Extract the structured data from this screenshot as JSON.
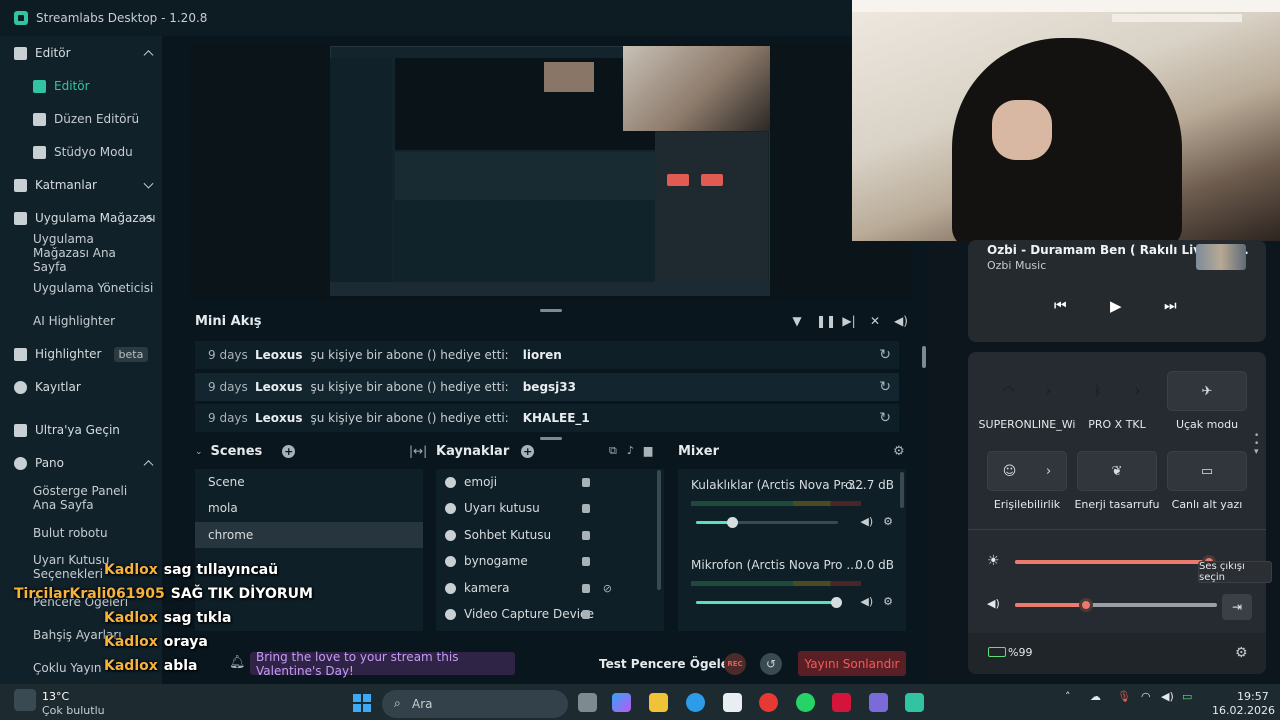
{
  "app": {
    "title": "Streamlabs Desktop - 1.20.8"
  },
  "sidebar": {
    "items": [
      {
        "label": "Editör"
      },
      {
        "label": "Editör"
      },
      {
        "label": "Düzen Editörü"
      },
      {
        "label": "Stüdyo Modu"
      },
      {
        "label": "Katmanlar"
      },
      {
        "label": "Uygulama Mağazası"
      },
      {
        "label": "Uygulama Mağazası Ana Sayfa"
      },
      {
        "label": "Uygulama Yöneticisi"
      },
      {
        "label": "AI Highlighter"
      },
      {
        "label": "Highlighter"
      },
      {
        "label": "Kayıtlar"
      },
      {
        "label": "Ultra'ya Geçin"
      },
      {
        "label": "Pano"
      },
      {
        "label": "Gösterge Paneli Ana Sayfa"
      },
      {
        "label": "Bulut robotu"
      },
      {
        "label": "Uyarı Kutusu Seçenekleri"
      },
      {
        "label": "Pencere Ögeleri"
      },
      {
        "label": "Bahşiş Ayarları"
      },
      {
        "label": "Çoklu Yayın"
      }
    ],
    "beta_badge": "beta"
  },
  "mini_feed": {
    "title": "Mini Akış",
    "rows": [
      {
        "age": "9 days",
        "user": "Leoxus",
        "text": "şu kişiye bir abone () hediye etti:",
        "target": "lioren"
      },
      {
        "age": "9 days",
        "user": "Leoxus",
        "text": "şu kişiye bir abone () hediye etti:",
        "target": "begsj33"
      },
      {
        "age": "9 days",
        "user": "Leoxus",
        "text": "şu kişiye bir abone () hediye etti:",
        "target": "KHALEE_1"
      }
    ]
  },
  "scenes": {
    "title": "Scenes",
    "items": [
      "Scene",
      "mola",
      "chrome"
    ],
    "selected": "chrome"
  },
  "sources": {
    "title": "Kaynaklar",
    "items": [
      "emoji",
      "Uyarı kutusu",
      "Sohbet Kutusu",
      "bynogame",
      "kamera",
      "Video Capture Device"
    ]
  },
  "mixer": {
    "title": "Mixer",
    "channels": [
      {
        "name": "Kulaklıklar (Arctis Nova Pro...",
        "value": "-32.7 dB",
        "level": 0.26
      },
      {
        "name": "Mikrofon (Arctis Nova Pro ...",
        "value": "0.0 dB",
        "level": 0.99
      }
    ]
  },
  "footer": {
    "banner": "Bring the love to your stream this Valentine's Day!",
    "test_label": "Test Pencere Ögeleri",
    "rec_label": "REC",
    "end_stream": "Yayını Sonlandır"
  },
  "chat_overlay": [
    {
      "user": "Kadlox",
      "msg": "sag tıllayıncaü"
    },
    {
      "user": "TircilarKrali061905",
      "msg": "SAĞ TIK DİYORUM"
    },
    {
      "user": "Kadlox",
      "msg": "sag tıkla"
    },
    {
      "user": "Kadlox",
      "msg": "oraya"
    },
    {
      "user": "Kadlox",
      "msg": "abla"
    }
  ],
  "media": {
    "title": "Ozbi - Duramam Ben ( Rakılı Live 4.S...",
    "artist": "Ozbi Music"
  },
  "quick_settings": {
    "tiles": [
      {
        "label": "SUPERONLINE_Wi",
        "on": true
      },
      {
        "label": "PRO X TKL",
        "on": true
      },
      {
        "label": "Uçak modu",
        "on": false
      },
      {
        "label": "Erişilebilirlik",
        "on": false
      },
      {
        "label": "Enerji tasarrufu",
        "on": false
      },
      {
        "label": "Canlı alt yazı",
        "on": false
      }
    ],
    "brightness": 0.97,
    "volume": 0.35,
    "tooltip": "Ses çıkışı seçin",
    "battery": "%99"
  },
  "weather": {
    "temp": "13°C",
    "desc": "Çok bulutlu"
  },
  "taskbar": {
    "search": "Ara",
    "time": "19:57",
    "date": "16.02.2026"
  },
  "colors": {
    "accent": "#31c3a2",
    "qs_on": "#ec7b6d",
    "chat_name": "#f7b23b"
  }
}
